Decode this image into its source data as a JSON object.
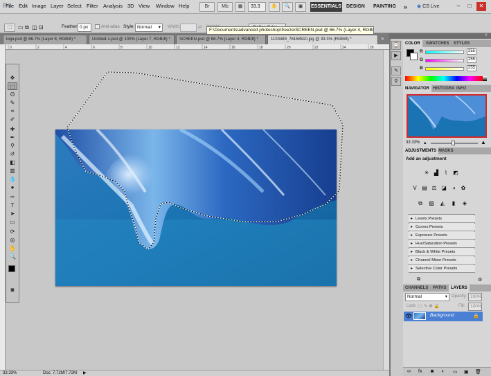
{
  "app": {
    "logo": "Ps"
  },
  "menu": [
    "File",
    "Edit",
    "Image",
    "Layer",
    "Select",
    "Filter",
    "Analysis",
    "3D",
    "View",
    "Window",
    "Help"
  ],
  "toolbar": {
    "zoom_value": "33.3",
    "dropdown_arrow": "▾"
  },
  "workspaces": {
    "essentials": "ESSENTIALS",
    "design": "DESIGN",
    "painting": "PAINTING",
    "more": "»",
    "cs_live": "CS Live"
  },
  "options": {
    "feather_label": "Feather:",
    "feather_value": "0 px",
    "anti_alias_label": "Anti-alias",
    "style_label": "Style:",
    "style_value": "Normal",
    "width_label": "Width:",
    "height_label": "Height:",
    "refine_edge": "Refine Edge..."
  },
  "tooltip": "F:\\Documents\\advanced photoshop\\freeze\\SCREEN.psd @ 66.7% (Layer 4, RGB/8)",
  "tabs": [
    {
      "label": "logo.psd @ 66.7% (Layer 8, RGB/8) *"
    },
    {
      "label": "Untitled-1.psd @ 100% (Layer 7, RGB/8) *"
    },
    {
      "label": "SCREEN.psd @ 66.7% (Layer 4, RGB/8) *"
    },
    {
      "label": "1103489_76158510.jpg @ 33.3% (RGB/8) *"
    }
  ],
  "ruler": {
    "top_ticks": [
      "0",
      "2",
      "4",
      "6",
      "8",
      "10",
      "12",
      "14",
      "16",
      "18",
      "20",
      "22",
      "24",
      "26"
    ]
  },
  "status": {
    "zoom": "33.33%",
    "doc": "Doc: 7.72M/7.72M"
  },
  "color_panel": {
    "tabs": [
      "COLOR",
      "SWATCHES",
      "STYLES"
    ],
    "channels": [
      {
        "label": "R",
        "value": "255"
      },
      {
        "label": "G",
        "value": "255"
      },
      {
        "label": "B",
        "value": "255"
      }
    ],
    "fg_color": "#000000",
    "bg_color": "#ffffff"
  },
  "navigator_panel": {
    "tabs": [
      "NAVIGATOR",
      "HISTOGRAM",
      "INFO"
    ],
    "zoom": "33.33%"
  },
  "adjustments_panel": {
    "tabs": [
      "ADJUSTMENTS",
      "MASKS"
    ],
    "heading": "Add an adjustment",
    "presets": [
      "Levels Presets",
      "Curves Presets",
      "Exposure Presets",
      "Hue/Saturation Presets",
      "Black & White Presets",
      "Channel Mixer Presets",
      "Selective Color Presets"
    ]
  },
  "layers_panel": {
    "tabs": [
      "CHANNELS",
      "PATHS",
      "LAYERS"
    ],
    "blend_mode": "Normal",
    "opacity_label": "Opacity:",
    "opacity_value": "100%",
    "lock_label": "Lock:",
    "fill_label": "Fill:",
    "fill_value": "100%",
    "layer_name": "Background"
  },
  "colors": {
    "accent_blue": "#2a6fbf",
    "selected_layer": "#4a7fd4",
    "workspace_active": "#3d3d3d"
  }
}
